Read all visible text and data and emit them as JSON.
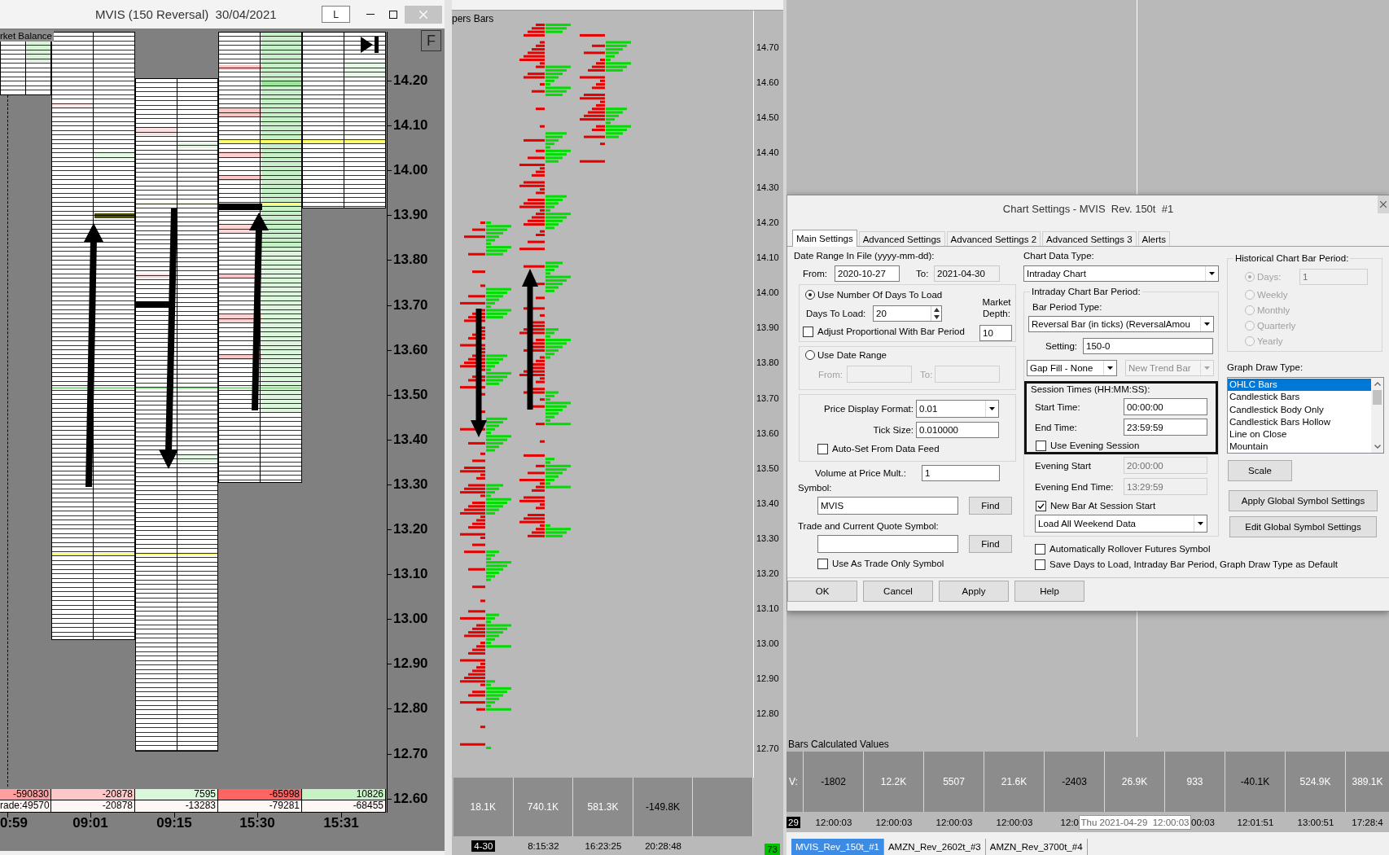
{
  "left_window": {
    "title": "MVIS (150 Reversal)  30/04/2021",
    "title_button": "L",
    "corner_button": "F",
    "study_label": "rket Balance",
    "price_axis": [
      "14.20",
      "14.10",
      "14.00",
      "13.90",
      "13.80",
      "13.70",
      "13.60",
      "13.50",
      "13.40",
      "13.30",
      "13.20",
      "13.10",
      "13.00",
      "12.90",
      "12.80",
      "12.70",
      "12.60"
    ],
    "summary_rows": [
      {
        "cells": [
          {
            "text": "-590830",
            "color": "#ff9e9e"
          },
          {
            "text": "-20878",
            "color": "#ffc8c8"
          },
          {
            "text": "7595",
            "color": "#d9f8d9"
          },
          {
            "text": "-65998",
            "color": "#ff6464"
          },
          {
            "text": "10826",
            "color": "#c6f2c6"
          }
        ]
      },
      {
        "cells": [
          {
            "text": "rade:49570"
          },
          {
            "text": "-20878"
          },
          {
            "text": "-13283"
          },
          {
            "text": "-79281"
          },
          {
            "text": "-68455"
          }
        ]
      }
    ],
    "time_axis": [
      "0:59",
      "09:01",
      "09:15",
      "15:30",
      "15:31"
    ]
  },
  "middle_window": {
    "study_label": "pers Bars",
    "price_axis": [
      "14.70",
      "14.60",
      "14.50",
      "14.40",
      "14.30",
      "14.20",
      "14.10",
      "14.00",
      "13.90",
      "13.80",
      "13.70",
      "13.60",
      "13.50",
      "13.40",
      "13.30",
      "13.20",
      "13.10",
      "13.00",
      "12.90",
      "12.80",
      "12.70"
    ],
    "values": [
      {
        "text": "18.1K",
        "color": "#ffffff"
      },
      {
        "text": "740.1K",
        "color": "#ffffff"
      },
      {
        "text": "581.3K",
        "color": "#ffffff"
      },
      {
        "text": "-149.8K",
        "color": "#000000"
      }
    ],
    "date_badge": "4-30",
    "time_axis": [
      "8:15:32",
      "16:23:25",
      "20:28:48"
    ],
    "count_badge": "73"
  },
  "settings_dialog": {
    "title": "Chart Settings - MVIS  Rev. 150t  #1",
    "tabs": [
      {
        "label": "Main Settings",
        "selected": true
      },
      {
        "label": "Advanced Settings",
        "selected": false
      },
      {
        "label": "Advanced Settings 2",
        "selected": false
      },
      {
        "label": "Advanced Settings 3",
        "selected": false
      },
      {
        "label": "Alerts",
        "selected": false
      }
    ],
    "date_range": {
      "label": "Date Range In File (yyyy-mm-dd):",
      "fields": [
        {
          "label": "From:",
          "value": "2020-10-27",
          "read_only": false
        },
        {
          "label": "To:",
          "value": "2021-04-30",
          "read_only": true
        }
      ]
    },
    "load_modes": [
      {
        "kind": "days",
        "label": "Use Number Of Days To Load",
        "selected": true,
        "days_label": "Days To Load:",
        "days_value": "20",
        "depth_label": "Market Depth:",
        "depth_value": "10",
        "option": {
          "label": "Adjust Proportional With Bar Period",
          "checked": false
        }
      },
      {
        "kind": "range",
        "label": "Use Date Range",
        "selected": false,
        "fields": [
          {
            "label": "From:",
            "disabled": true
          },
          {
            "label": "To:",
            "disabled": true
          }
        ]
      }
    ],
    "price": {
      "fields": [
        {
          "kind": "dropdown",
          "label": "Price Display Format:",
          "value": "0.01"
        },
        {
          "kind": "text",
          "label": "Tick Size:",
          "value": "0.010000"
        }
      ],
      "option": {
        "label": "Auto-Set From Data Feed",
        "checked": false
      }
    },
    "volume_mult": {
      "label": "Volume at Price Mult.:",
      "value": "1"
    },
    "symbols": [
      {
        "label": "Symbol:",
        "value": "MVIS",
        "button": "Find"
      },
      {
        "label": "Trade and Current Quote Symbol:",
        "button": "Find"
      }
    ],
    "trade_only": {
      "label": "Use As Trade Only Symbol",
      "checked": false
    },
    "chart_data_type": {
      "label": "Chart Data Type:",
      "value": "Intraday Chart"
    },
    "bar_period": {
      "title": "Intraday Chart Bar Period:",
      "type_label": "Bar Period Type:",
      "type_value": "Reversal Bar (in ticks) (ReversalAmou",
      "setting_label": "Setting:",
      "setting_value": "150-0",
      "dropdowns": [
        {
          "value": "Gap Fill - None",
          "disabled": false
        },
        {
          "value": "New Trend Bar",
          "disabled": true
        }
      ]
    },
    "session": {
      "title": "Session Times (HH:MM:SS):",
      "highlighted": true,
      "times": [
        {
          "label": "Start Time:",
          "value": "00:00:00"
        },
        {
          "label": "End Time:",
          "value": "23:59:59"
        }
      ],
      "option": {
        "label": "Use Evening Session",
        "checked": false
      }
    },
    "evening": [
      {
        "label": "Evening Start",
        "value": "20:00:00",
        "disabled": true
      },
      {
        "label": "Evening End Time:",
        "value": "13:29:59",
        "disabled": true
      }
    ],
    "new_bar": {
      "label": "New Bar At Session Start",
      "checked": true
    },
    "weekend": {
      "value": "Load All Weekend Data"
    },
    "options": [
      {
        "label": "Automatically Rollover Futures Symbol",
        "checked": false
      },
      {
        "label": "Save Days to Load, Intraday Bar Period, Graph Draw Type as Default",
        "checked": false
      }
    ],
    "historical": {
      "title": "Historical Chart Bar Period:",
      "disabled": true,
      "periods": [
        {
          "label": "Days:",
          "selected": true
        },
        {
          "label": "Weekly",
          "selected": false
        },
        {
          "label": "Monthly",
          "selected": false
        },
        {
          "label": "Quarterly",
          "selected": false
        },
        {
          "label": "Yearly",
          "selected": false
        }
      ],
      "days_value": "1"
    },
    "draw_type": {
      "label": "Graph Draw Type:",
      "items": [
        {
          "label": "OHLC Bars",
          "selected": true
        },
        {
          "label": "Candlestick Bars",
          "selected": false
        },
        {
          "label": "Candlestick Body Only",
          "selected": false
        },
        {
          "label": "Candlestick Bars Hollow",
          "selected": false
        },
        {
          "label": "Line on Close",
          "selected": false
        },
        {
          "label": "Mountain",
          "selected": false
        }
      ]
    },
    "side_buttons": [
      "Scale",
      "Apply Global Symbol Settings",
      "Edit Global Symbol Settings"
    ],
    "footer_buttons": [
      "OK",
      "Cancel",
      "Apply",
      "Help"
    ]
  },
  "right_window": {
    "study_label": "Bars Calculated Values",
    "values": [
      {
        "text": "V:",
        "color": "#ffffff"
      },
      {
        "text": "-1802",
        "color": "#000000"
      },
      {
        "text": "12.2K",
        "color": "#ffffff"
      },
      {
        "text": "5507",
        "color": "#ffffff"
      },
      {
        "text": "21.6K",
        "color": "#ffffff"
      },
      {
        "text": "-2403",
        "color": "#000000"
      },
      {
        "text": "26.9K",
        "color": "#ffffff"
      },
      {
        "text": "933",
        "color": "#ffffff"
      },
      {
        "text": "-40.1K",
        "color": "#000000"
      },
      {
        "text": "524.9K",
        "color": "#ffffff"
      },
      {
        "text": "389.1K",
        "color": "#ffffff"
      }
    ],
    "date_badge": "29",
    "time_axis": [
      {
        "kind": "label",
        "text": "12:00:03"
      },
      {
        "kind": "label",
        "text": "12:00:03"
      },
      {
        "kind": "label",
        "text": "12:00:03"
      },
      {
        "kind": "label",
        "text": "12:00:03"
      },
      {
        "kind": "label",
        "text": "12:0"
      },
      {
        "kind": "tooltip",
        "text": "Thu 2021-04-29  12:00:03"
      },
      {
        "kind": "label",
        "text": "00:03"
      },
      {
        "kind": "label",
        "text": "12:01:51"
      },
      {
        "kind": "label",
        "text": "13:00:51"
      },
      {
        "kind": "label",
        "text": "17:28:4"
      }
    ]
  },
  "chartbook_tabs": [
    {
      "label": "MVIS_Rev_150t_#1",
      "selected": true
    },
    {
      "label": "AMZN_Rev_2602t_#3",
      "selected": false
    },
    {
      "label": "AMZN_Rev_3700t_#4",
      "selected": false
    }
  ]
}
